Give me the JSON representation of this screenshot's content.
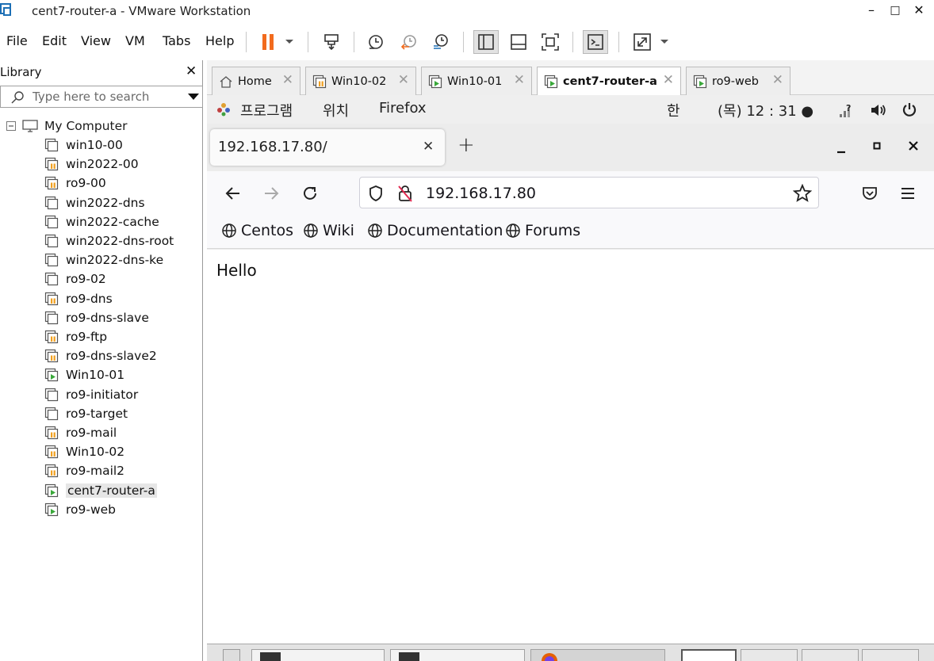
{
  "window": {
    "title": "cent7-router-a - VMware Workstation",
    "controls": {
      "minimize": "–",
      "maximize": "□",
      "close": "✕"
    }
  },
  "menubar": {
    "items": [
      "File",
      "Edit",
      "View",
      "VM",
      "Tabs",
      "Help"
    ]
  },
  "library": {
    "title": "Library",
    "close": "✕",
    "search_placeholder": "Type here to search",
    "root": "My Computer",
    "vms": [
      {
        "name": "win10-00",
        "state": "off"
      },
      {
        "name": "win2022-00",
        "state": "suspended"
      },
      {
        "name": "ro9-00",
        "state": "suspended"
      },
      {
        "name": "win2022-dns",
        "state": "off"
      },
      {
        "name": "win2022-cache",
        "state": "off"
      },
      {
        "name": "win2022-dns-root",
        "state": "off"
      },
      {
        "name": "win2022-dns-ke",
        "state": "off"
      },
      {
        "name": "ro9-02",
        "state": "off"
      },
      {
        "name": "ro9-dns",
        "state": "suspended"
      },
      {
        "name": "ro9-dns-slave",
        "state": "off"
      },
      {
        "name": "ro9-ftp",
        "state": "suspended"
      },
      {
        "name": "ro9-dns-slave2",
        "state": "suspended"
      },
      {
        "name": "Win10-01",
        "state": "running"
      },
      {
        "name": "ro9-initiator",
        "state": "off"
      },
      {
        "name": "ro9-target",
        "state": "off"
      },
      {
        "name": "ro9-mail",
        "state": "suspended"
      },
      {
        "name": "Win10-02",
        "state": "suspended"
      },
      {
        "name": "ro9-mail2",
        "state": "suspended"
      },
      {
        "name": "cent7-router-a",
        "state": "running",
        "selected": true
      },
      {
        "name": "ro9-web",
        "state": "running"
      }
    ]
  },
  "vm_tabs": [
    {
      "label": "Home",
      "type": "home"
    },
    {
      "label": "Win10-02",
      "type": "suspended"
    },
    {
      "label": "Win10-01",
      "type": "running"
    },
    {
      "label": "cent7-router-a",
      "type": "running",
      "active": true
    },
    {
      "label": "ro9-web",
      "type": "running"
    }
  ],
  "gnome": {
    "applications": "프로그램",
    "places": "위치",
    "firefox": "Firefox",
    "input_method": "한",
    "clock": "(목) 12 : 31 ●"
  },
  "firefox": {
    "tab_title": "192.168.17.80/",
    "tab_close": "✕",
    "new_tab": "+",
    "url": "192.168.17.80",
    "bookmarks": [
      "Centos",
      "Wiki",
      "Documentation",
      "Forums"
    ],
    "page_text": "Hello"
  },
  "colors": {
    "pause_orange": "#f26b1d",
    "running_green": "#3aa83a",
    "suspended_orange": "#f0a020"
  }
}
